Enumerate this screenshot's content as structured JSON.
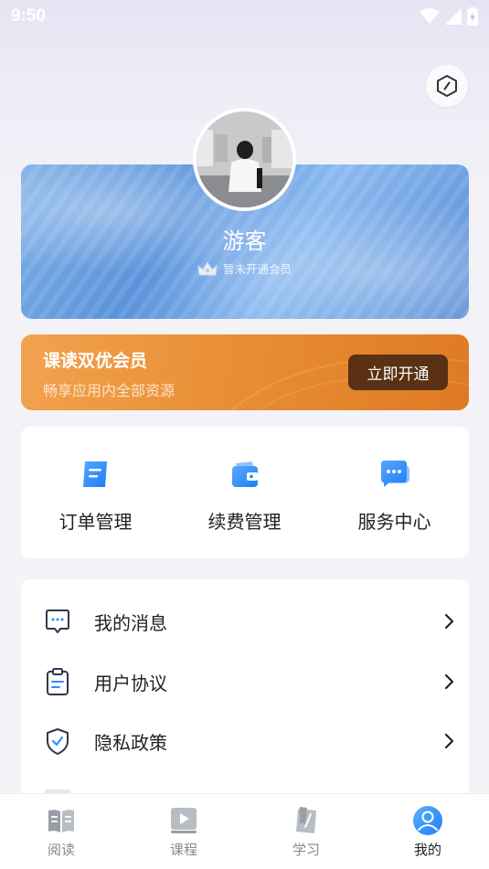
{
  "status_bar": {
    "time": "9:50"
  },
  "profile": {
    "username": "游客",
    "membership_status": "暂未开通会员"
  },
  "vip_banner": {
    "title": "课读双优会员",
    "subtitle": "畅享应用内全部资源",
    "button_label": "立即开通"
  },
  "quick_actions": [
    {
      "label": "订单管理",
      "icon": "order-icon"
    },
    {
      "label": "续费管理",
      "icon": "wallet-icon"
    },
    {
      "label": "服务中心",
      "icon": "chat-bubble-icon"
    }
  ],
  "menu": [
    {
      "label": "我的消息",
      "icon": "message-icon"
    },
    {
      "label": "用户协议",
      "icon": "clipboard-icon"
    },
    {
      "label": "隐私政策",
      "icon": "shield-check-icon"
    }
  ],
  "tabs": [
    {
      "label": "阅读",
      "icon": "book-icon",
      "active": false
    },
    {
      "label": "课程",
      "icon": "video-play-icon",
      "active": false
    },
    {
      "label": "学习",
      "icon": "notebook-icon",
      "active": false
    },
    {
      "label": "我的",
      "icon": "user-icon",
      "active": true
    }
  ],
  "colors": {
    "accent_blue": "#2f8df5",
    "vip_orange": "#e98f35",
    "vip_button": "#5a3112"
  }
}
